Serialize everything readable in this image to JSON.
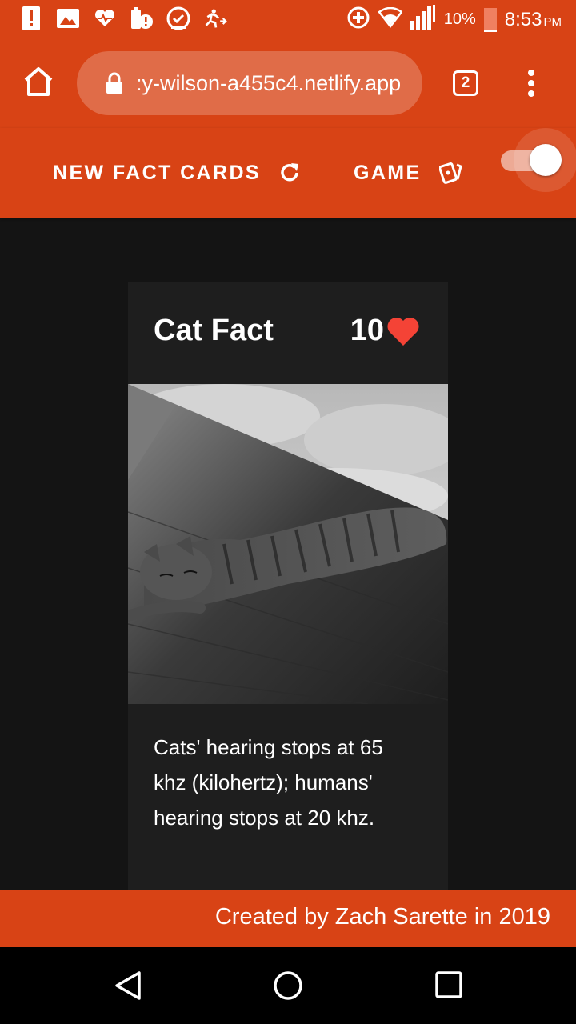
{
  "status_bar": {
    "battery_percent": "10%",
    "time": "8:53",
    "ampm": "PM",
    "icons": [
      "alert-icon",
      "image-icon",
      "heart-monitor-icon",
      "battery-alert-icon",
      "check-circle-icon",
      "running-icon",
      "data-saver-icon",
      "wifi-icon",
      "signal-icon",
      "battery-icon"
    ]
  },
  "browser": {
    "url": "‎:y-wilson-a455c4.netlify.app",
    "tab_count": "2",
    "icons": [
      "home-icon",
      "lock-icon",
      "more-vert-icon"
    ]
  },
  "app_nav": {
    "new_cards_label": "NEW FACT CARDS",
    "game_label": "GAME",
    "toggle_on": true,
    "icons": [
      "refresh-icon",
      "cards-icon"
    ]
  },
  "card": {
    "title": "Cat Fact",
    "likes": "10",
    "fact": "Cats' hearing stops at 65 khz (kilohertz); humans' hearing stops at 20 khz.",
    "image_icon": "cat-photo"
  },
  "footer": {
    "text": "Created by Zach Sarette in 2019"
  },
  "colors": {
    "primary": "#d84315",
    "background": "#141414",
    "card": "#1e1e1e",
    "heart": "#f44336"
  }
}
